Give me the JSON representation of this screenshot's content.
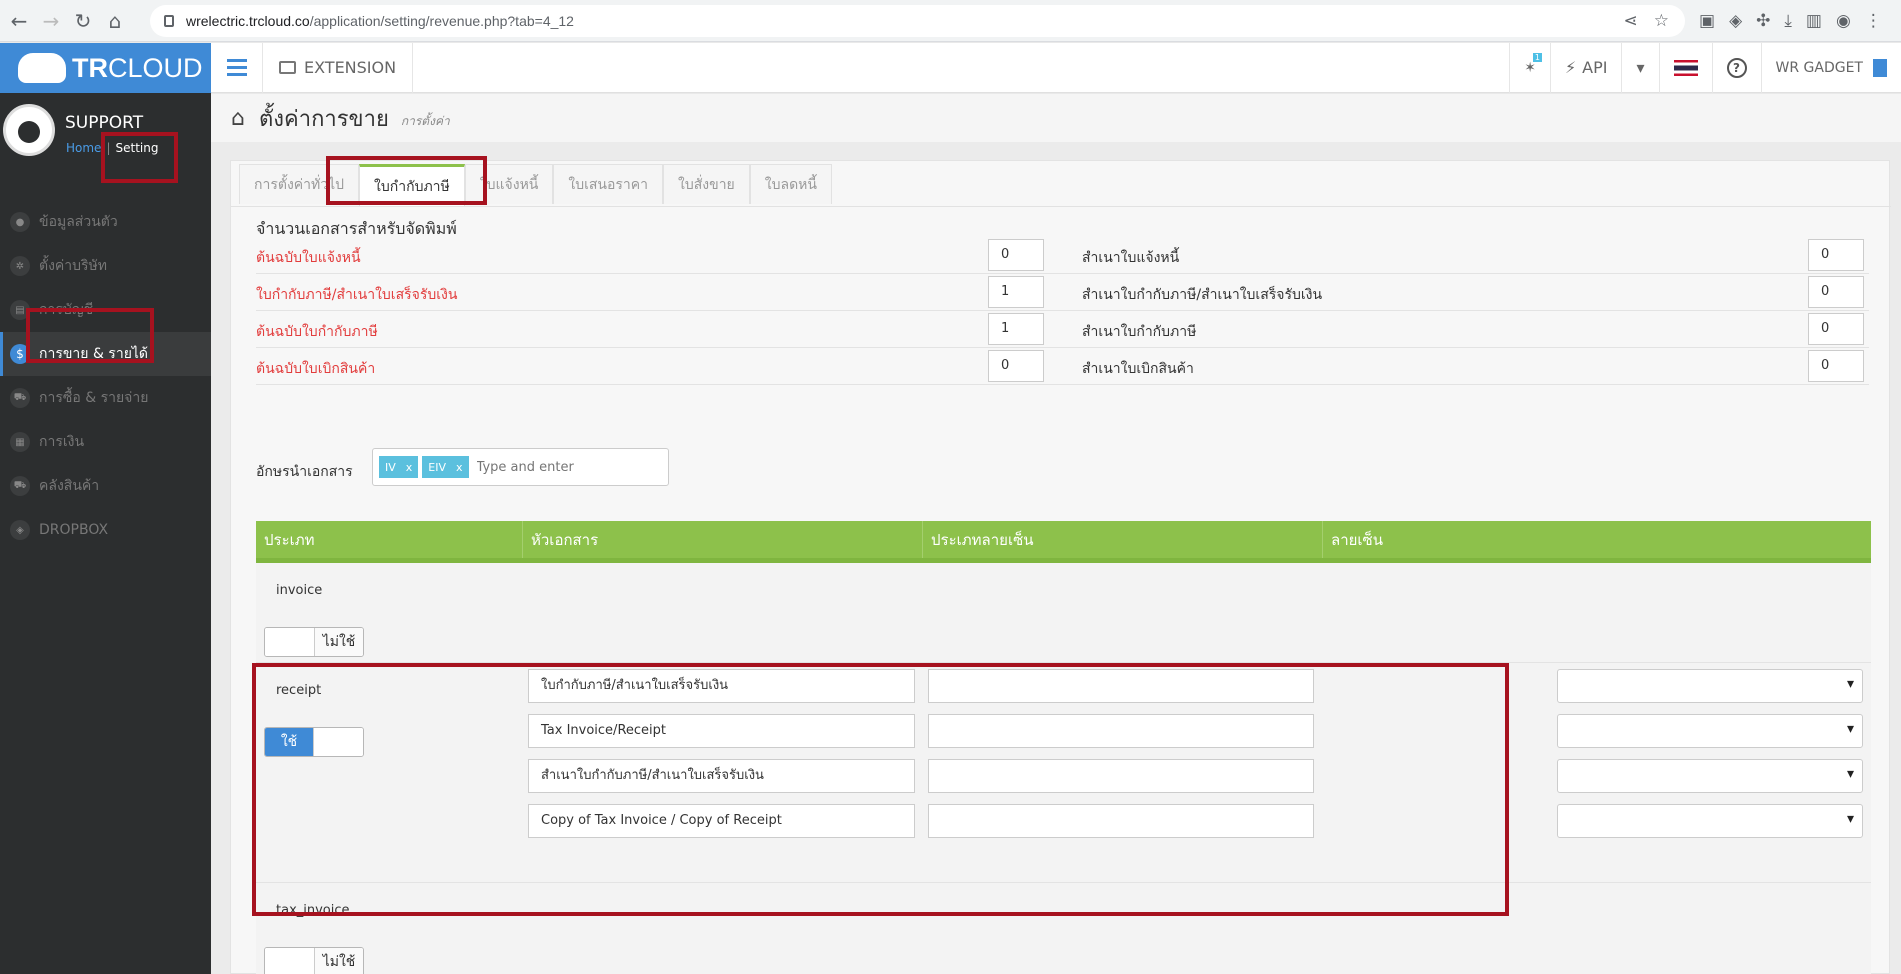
{
  "browser": {
    "url_host": "wrelectric.trcloud.co",
    "url_path": "/application/setting/revenue.php?tab=4_12"
  },
  "sidebar": {
    "logo_bold": "TR",
    "logo_light": "CLOUD",
    "profile_name": "SUPPORT",
    "link_home": "Home",
    "link_setting": "Setting",
    "items": [
      {
        "label": "ข้อมูลส่วนตัว",
        "icon": "person-icon",
        "glyph": "●"
      },
      {
        "label": "ตั้งค่าบริษัท",
        "icon": "gear-icon",
        "glyph": "✲"
      },
      {
        "label": "การบัญชี",
        "icon": "book-icon",
        "glyph": "▤"
      },
      {
        "label": "การขาย & รายได้",
        "icon": "dollar-icon",
        "glyph": "$"
      },
      {
        "label": "การซื้อ & รายจ่าย",
        "icon": "cart-icon",
        "glyph": "⛟"
      },
      {
        "label": "การเงิน",
        "icon": "calendar-icon",
        "glyph": "▦"
      },
      {
        "label": "คลังสินค้า",
        "icon": "truck-icon",
        "glyph": "⛟"
      },
      {
        "label": "DROPBOX",
        "icon": "dropbox-icon",
        "glyph": "◈"
      }
    ]
  },
  "header": {
    "extension_label": "EXTENSION",
    "badge_count": "1",
    "api_label": "API",
    "company_label": "WR GADGET"
  },
  "page": {
    "title": "ตั้งค่าการขาย",
    "subtitle": "การตั้งค่า"
  },
  "tabs": [
    "การตั้งค่าทั่วไป",
    "ใบกำกับภาษี",
    "ใบแจ้งหนี้",
    "ใบเสนอราคา",
    "ใบสั่งขาย",
    "ใบลดหนี้"
  ],
  "print_copies": {
    "section_title": "จำนวนเอกสารสำหรับจัดพิมพ์",
    "rows": [
      {
        "left_label": "ต้นฉบับใบแจ้งหนี้",
        "left_value": "0",
        "right_label": "สำเนาใบแจ้งหนี้",
        "right_value": "0"
      },
      {
        "left_label": "ใบกำกับภาษี/สำเนาใบเสร็จรับเงิน",
        "left_value": "1",
        "right_label": "สำเนาใบกำกับภาษี/สำเนาใบเสร็จรับเงิน",
        "right_value": "0"
      },
      {
        "left_label": "ต้นฉบับใบกำกับภาษี",
        "left_value": "1",
        "right_label": "สำเนาใบกำกับภาษี",
        "right_value": "0"
      },
      {
        "left_label": "ต้นฉบับใบเบิกสินค้า",
        "left_value": "0",
        "right_label": "สำเนาใบเบิกสินค้า",
        "right_value": "0"
      }
    ]
  },
  "prefix": {
    "label": "อักษรนำเอกสาร",
    "tags": [
      "IV",
      "EIV"
    ],
    "tag_remove": "x",
    "placeholder": "Type and enter"
  },
  "grid": {
    "headers": [
      "ประเภท",
      "หัวเอกสาร",
      "ประเภทลายเซ็น",
      "ลายเซ็น"
    ],
    "rows": [
      {
        "type": "invoice",
        "toggle_label": "ไม่ใช้",
        "enabled": false
      },
      {
        "type": "receipt",
        "toggle_label": "ใช้",
        "enabled": true,
        "headings": [
          "ใบกำกับภาษี/สำเนาใบเสร็จรับเงิน",
          "Tax Invoice/Receipt",
          "สำเนาใบกำกับภาษี/สำเนาใบเสร็จรับเงิน",
          "Copy of Tax Invoice / Copy of Receipt"
        ]
      },
      {
        "type": "tax_invoice",
        "toggle_label": "ไม่ใช้",
        "enabled": false
      }
    ]
  },
  "colors": {
    "accent_blue": "#3f8ad6",
    "grid_green": "#8dc14b",
    "required_red": "#e23d3d",
    "annotation_red": "#a6121f"
  }
}
